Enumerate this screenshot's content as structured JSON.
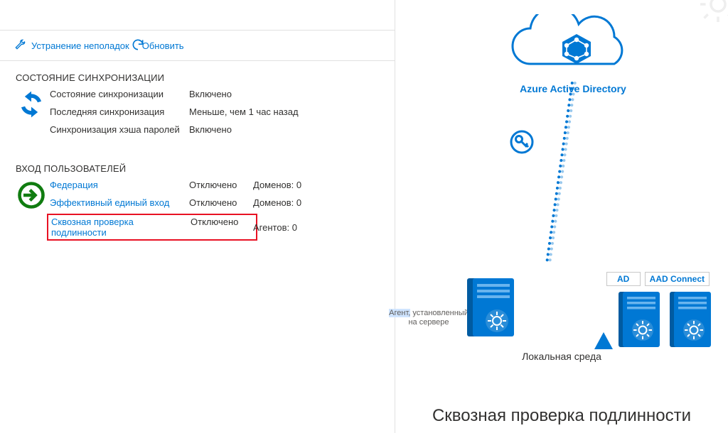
{
  "toolbar": {
    "troubleshoot_label": "Устранение неполадок",
    "refresh_label": "Обновить"
  },
  "sync_section": {
    "title": "СОСТОЯНИЕ СИНХРОНИЗАЦИИ",
    "rows": {
      "state_label": "Состояние синхронизации",
      "state_value": "Включено",
      "last_label": "Последняя синхронизация",
      "last_value": "Меньше, чем 1 час назад",
      "hash_label": "Синхронизация хэша паролей",
      "hash_value": "Включено"
    }
  },
  "signin_section": {
    "title": "ВХОД ПОЛЬЗОВАТЕЛЕЙ",
    "federation": {
      "label": "Федерация",
      "status": "Отключено",
      "count": "Доменов: 0"
    },
    "sso": {
      "label": "Эффективный единый вход",
      "status": "Отключено",
      "count": "Доменов: 0"
    },
    "passthrough": {
      "label": "Сквозная проверка подлинности",
      "status": "Отключено",
      "count": "Агентов: 0"
    }
  },
  "diagram": {
    "cloud_title": "Azure Active Directory",
    "label_ad": "AD",
    "label_aad": "AAD Connect",
    "onprem_caption": "Локальная среда",
    "agent_note_a": "Агент,",
    "agent_note_b": "установленный",
    "agent_note_c": "на сервере",
    "footer_title": "Сквозная проверка подлинности"
  }
}
